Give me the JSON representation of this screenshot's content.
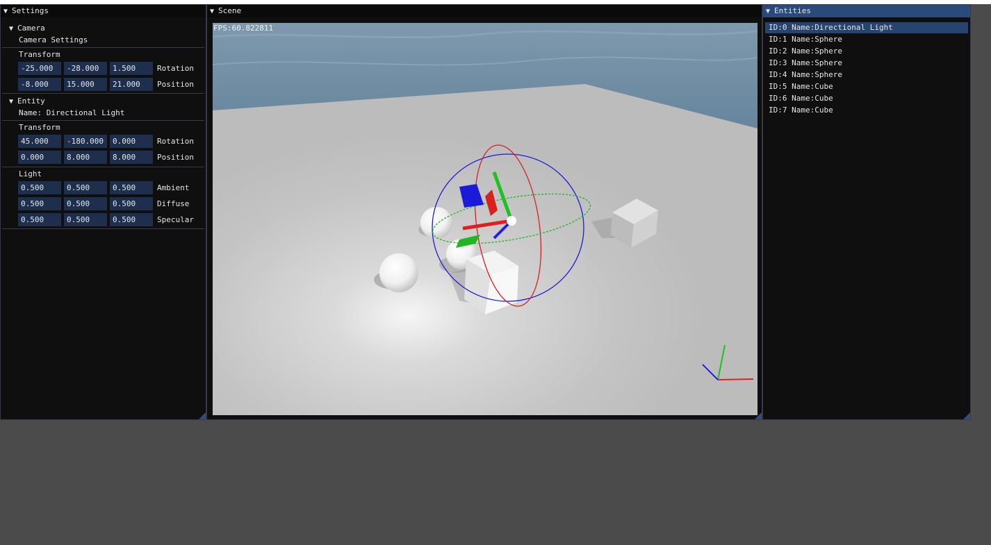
{
  "settings": {
    "title": "Settings",
    "camera": {
      "header": "Camera",
      "subtitle": "Camera Settings",
      "transform_label": "Transform",
      "rotation": [
        "-25.000",
        "-28.000",
        "1.500"
      ],
      "rotation_label": "Rotation",
      "position": [
        "-8.000",
        "15.000",
        "21.000"
      ],
      "position_label": "Position"
    },
    "entity": {
      "header": "Entity",
      "name_line": "Name: Directional Light",
      "transform_label": "Transform",
      "rotation": [
        "45.000",
        "-180.000",
        "0.000"
      ],
      "rotation_label": "Rotation",
      "position": [
        "0.000",
        "8.000",
        "8.000"
      ],
      "position_label": "Position"
    },
    "light": {
      "header": "Light",
      "ambient": [
        "0.500",
        "0.500",
        "0.500"
      ],
      "ambient_label": "Ambient",
      "diffuse": [
        "0.500",
        "0.500",
        "0.500"
      ],
      "diffuse_label": "Diffuse",
      "specular": [
        "0.500",
        "0.500",
        "0.500"
      ],
      "specular_label": "Specular"
    }
  },
  "scene": {
    "title": "Scene",
    "fps_text": "FPS:60.822811"
  },
  "entities": {
    "title": "Entities",
    "items": [
      "ID:0 Name:Directional Light",
      "ID:1 Name:Sphere",
      "ID:2 Name:Sphere",
      "ID:3 Name:Sphere",
      "ID:4 Name:Sphere",
      "ID:5 Name:Cube",
      "ID:6 Name:Cube",
      "ID:7 Name:Cube"
    ],
    "selected_index": 0
  },
  "icons": {
    "collapse": "triangle-down-icon",
    "resize": "resize-grip-icon",
    "gizmo": "rotate-gizmo-icon",
    "axes": "xyz-axes-icon"
  },
  "colors": {
    "field_bg": "#1d2f4d",
    "selected_row": "#26446f",
    "active_title": "#294a7a",
    "axis_x": "#e02020",
    "axis_y": "#20c020",
    "axis_z": "#2020e0"
  }
}
